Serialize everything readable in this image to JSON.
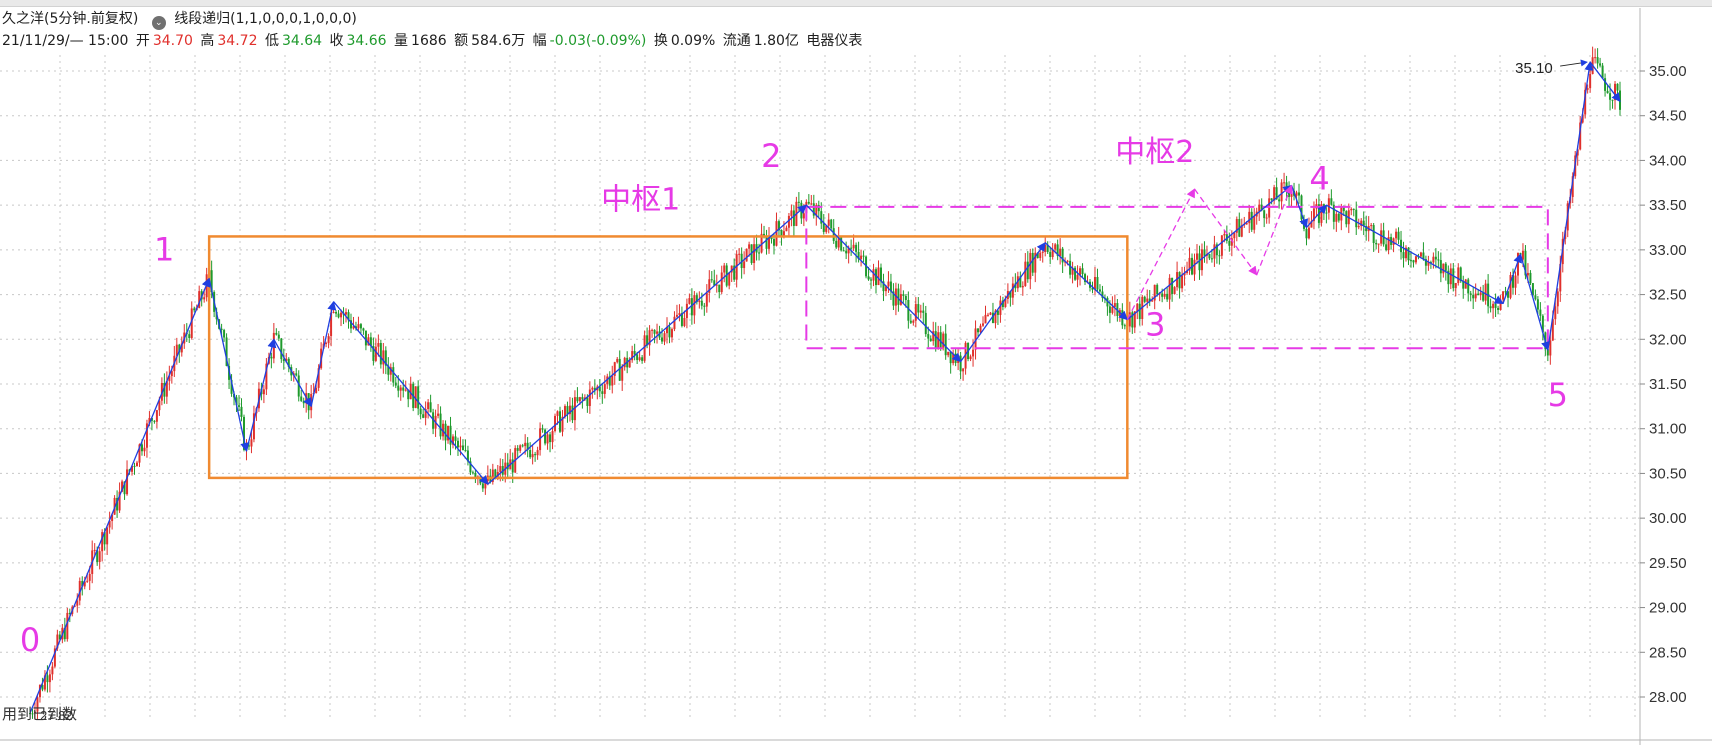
{
  "header": {
    "stock_name": "久之洋(5分钟.前复权)",
    "indicator": "线段递归(1,1,0,0,0,1,0,0,0)",
    "date_time": "21/11/29/— 15:00",
    "open_label": "开",
    "open_value": "34.70",
    "high_label": "高",
    "high_value": "34.72",
    "low_label": "低",
    "low_value": "34.64",
    "close_label": "收",
    "close_value": "34.66",
    "volume_label": "量",
    "volume_value": "1686",
    "amount_label": "额",
    "amount_value": "584.6万",
    "change_label": "幅",
    "change_value": "-0.03(-0.09%)",
    "turnover_label": "换",
    "turnover_value": "0.09%",
    "float_label": "流通",
    "float_value": "1.80亿",
    "sector": "电器仪表"
  },
  "footer": {
    "left_text": "用到已到数",
    "low_marker": "27.82"
  },
  "colors": {
    "up": "#e0302c",
    "down": "#1e9a2c",
    "segment": "#1f3fe0",
    "pivot_box_1": "#f08a30",
    "pivot_box_2": "#e63ae6",
    "label": "#e63ae6",
    "grid": "#c8c8c8",
    "axis_text": "#333333"
  },
  "chart_data": {
    "type": "candlestick",
    "y_axis": {
      "min": 27.8,
      "max": 35.3,
      "side": "right",
      "ticks": [
        "28.00",
        "28.50",
        "29.00",
        "29.50",
        "30.00",
        "30.50",
        "31.00",
        "31.50",
        "32.00",
        "32.50",
        "33.00",
        "33.50",
        "34.00",
        "34.50",
        "35.00"
      ]
    },
    "grid": true,
    "bar_count": 640,
    "segment_points": [
      {
        "i": 0,
        "p": 27.82
      },
      {
        "i": 72,
        "p": 32.68
      },
      {
        "i": 87,
        "p": 30.75
      },
      {
        "i": 98,
        "p": 32.0
      },
      {
        "i": 113,
        "p": 31.25
      },
      {
        "i": 122,
        "p": 32.42
      },
      {
        "i": 184,
        "p": 30.38
      },
      {
        "i": 312,
        "p": 33.5
      },
      {
        "i": 374,
        "p": 31.75
      },
      {
        "i": 408,
        "p": 33.08
      },
      {
        "i": 441,
        "p": 32.22
      },
      {
        "i": 507,
        "p": 33.72
      },
      {
        "i": 513,
        "p": 33.25
      },
      {
        "i": 521,
        "p": 33.5
      },
      {
        "i": 592,
        "p": 32.4
      },
      {
        "i": 599,
        "p": 32.95
      },
      {
        "i": 610,
        "p": 31.88
      },
      {
        "i": 627,
        "p": 35.1
      },
      {
        "i": 639,
        "p": 34.66
      }
    ],
    "sub_segment_points": [
      {
        "i": 441,
        "p": 32.22
      },
      {
        "i": 468,
        "p": 33.68
      },
      {
        "i": 493,
        "p": 32.72
      },
      {
        "i": 507,
        "p": 33.72
      }
    ],
    "pivot_zones": [
      {
        "label": "中枢1",
        "i_start": 72,
        "i_end": 441,
        "low": 30.45,
        "high": 33.15,
        "style": "solid"
      },
      {
        "label": "中枢2",
        "i_start": 312,
        "i_end": 610,
        "low": 31.9,
        "high": 33.48,
        "style": "dashed"
      }
    ],
    "point_labels": [
      {
        "text": "0",
        "i": 0,
        "p": 27.82
      },
      {
        "text": "1",
        "i": 72,
        "p": 32.68
      },
      {
        "text": "2",
        "i": 312,
        "p": 33.5
      },
      {
        "text": "3",
        "i": 441,
        "p": 32.22
      },
      {
        "text": "4",
        "i": 507,
        "p": 33.72
      },
      {
        "text": "5",
        "i": 610,
        "p": 31.88
      }
    ],
    "high_annotation": {
      "text": "35.10",
      "i": 627,
      "p": 35.1
    }
  }
}
